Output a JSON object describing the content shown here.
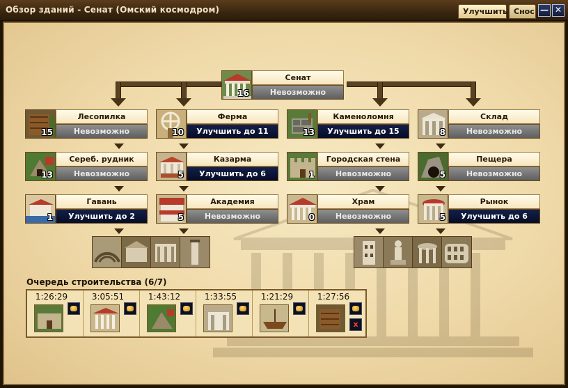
{
  "window": {
    "title": "Обзор зданий - Сенат (Омский космодром)",
    "tab_upgrade": "Улучшить",
    "tab_demolish": "Снос",
    "minimize_glyph": "—",
    "close_glyph": "✕"
  },
  "buildings": {
    "senate": {
      "name": "Сенат",
      "level": "16",
      "action": "Невозможно",
      "state": "off"
    },
    "lumber": {
      "name": "Лесопилка",
      "level": "15",
      "action": "Невозможно",
      "state": "off"
    },
    "farm": {
      "name": "Ферма",
      "level": "10",
      "action": "Улучшить до 11",
      "state": "on"
    },
    "quarry": {
      "name": "Каменоломня",
      "level": "13",
      "action": "Улучшить до 15",
      "state": "on"
    },
    "warehouse": {
      "name": "Склад",
      "level": "8",
      "action": "Невозможно",
      "state": "off"
    },
    "silver": {
      "name": "Сереб. рудник",
      "level": "13",
      "action": "Невозможно",
      "state": "off"
    },
    "barracks": {
      "name": "Казарма",
      "level": "5",
      "action": "Улучшить до 6",
      "state": "on"
    },
    "wall": {
      "name": "Городская стена",
      "level": "1",
      "action": "Невозможно",
      "state": "off"
    },
    "cave": {
      "name": "Пещера",
      "level": "5",
      "action": "Невозможно",
      "state": "off"
    },
    "harbor": {
      "name": "Гавань",
      "level": "1",
      "action": "Улучшить до 2",
      "state": "on"
    },
    "academy": {
      "name": "Академия",
      "level": "5",
      "action": "Невозможно",
      "state": "off"
    },
    "temple": {
      "name": "Храм",
      "level": "0",
      "action": "Невозможно",
      "state": "off"
    },
    "market": {
      "name": "Рынок",
      "level": "5",
      "action": "Улучшить до 6",
      "state": "on"
    }
  },
  "queue": {
    "title": "Очередь строительства (6/7)",
    "items": [
      {
        "time": "1:26:29"
      },
      {
        "time": "3:05:51"
      },
      {
        "time": "1:43:12"
      },
      {
        "time": "1:33:55"
      },
      {
        "time": "1:21:29"
      },
      {
        "time": "1:27:56",
        "cancel": "x"
      }
    ]
  },
  "colors": {
    "action_on": "#0a1433",
    "action_off": "#707070",
    "frame": "#3a2610",
    "parchment": "#f3e2b6"
  }
}
